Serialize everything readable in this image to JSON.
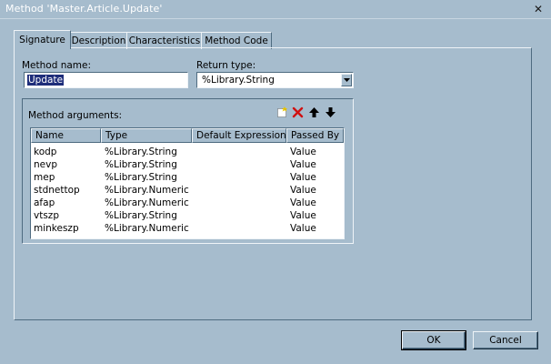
{
  "window": {
    "title": "Method 'Master.Article.Update'",
    "close_glyph": "✕"
  },
  "tabs": [
    {
      "label": "Signature",
      "active": true
    },
    {
      "label": "Description",
      "active": false
    },
    {
      "label": "Characteristics",
      "active": false
    },
    {
      "label": "Method Code",
      "active": false
    }
  ],
  "signature": {
    "method_name_label": "Method name:",
    "method_name_value": "Update",
    "return_type_label": "Return type:",
    "return_type_value": "%Library.String"
  },
  "arguments": {
    "group_label": "Method arguments:",
    "toolbar": {
      "new_icon": "new-argument-icon",
      "delete_icon": "delete-argument-icon",
      "up_icon": "move-up-arrow-icon",
      "down_icon": "move-down-arrow-icon"
    },
    "columns": [
      "Name",
      "Type",
      "Default Expression",
      "Passed By"
    ],
    "rows": [
      {
        "name": "kodp",
        "type": "%Library.String",
        "default": "",
        "passed_by": "Value"
      },
      {
        "name": "nevp",
        "type": "%Library.String",
        "default": "",
        "passed_by": "Value"
      },
      {
        "name": "mep",
        "type": "%Library.String",
        "default": "",
        "passed_by": "Value"
      },
      {
        "name": "stdnettop",
        "type": "%Library.Numeric",
        "default": "",
        "passed_by": "Value"
      },
      {
        "name": "afap",
        "type": "%Library.Numeric",
        "default": "",
        "passed_by": "Value"
      },
      {
        "name": "vtszp",
        "type": "%Library.String",
        "default": "",
        "passed_by": "Value"
      },
      {
        "name": "minkeszp",
        "type": "%Library.Numeric",
        "default": "",
        "passed_by": "Value"
      }
    ]
  },
  "buttons": {
    "ok_label": "OK",
    "cancel_label": "Cancel"
  },
  "colors": {
    "background": "#a6bccd",
    "selection": "#1e2d7a",
    "delete_icon": "#d01010"
  }
}
